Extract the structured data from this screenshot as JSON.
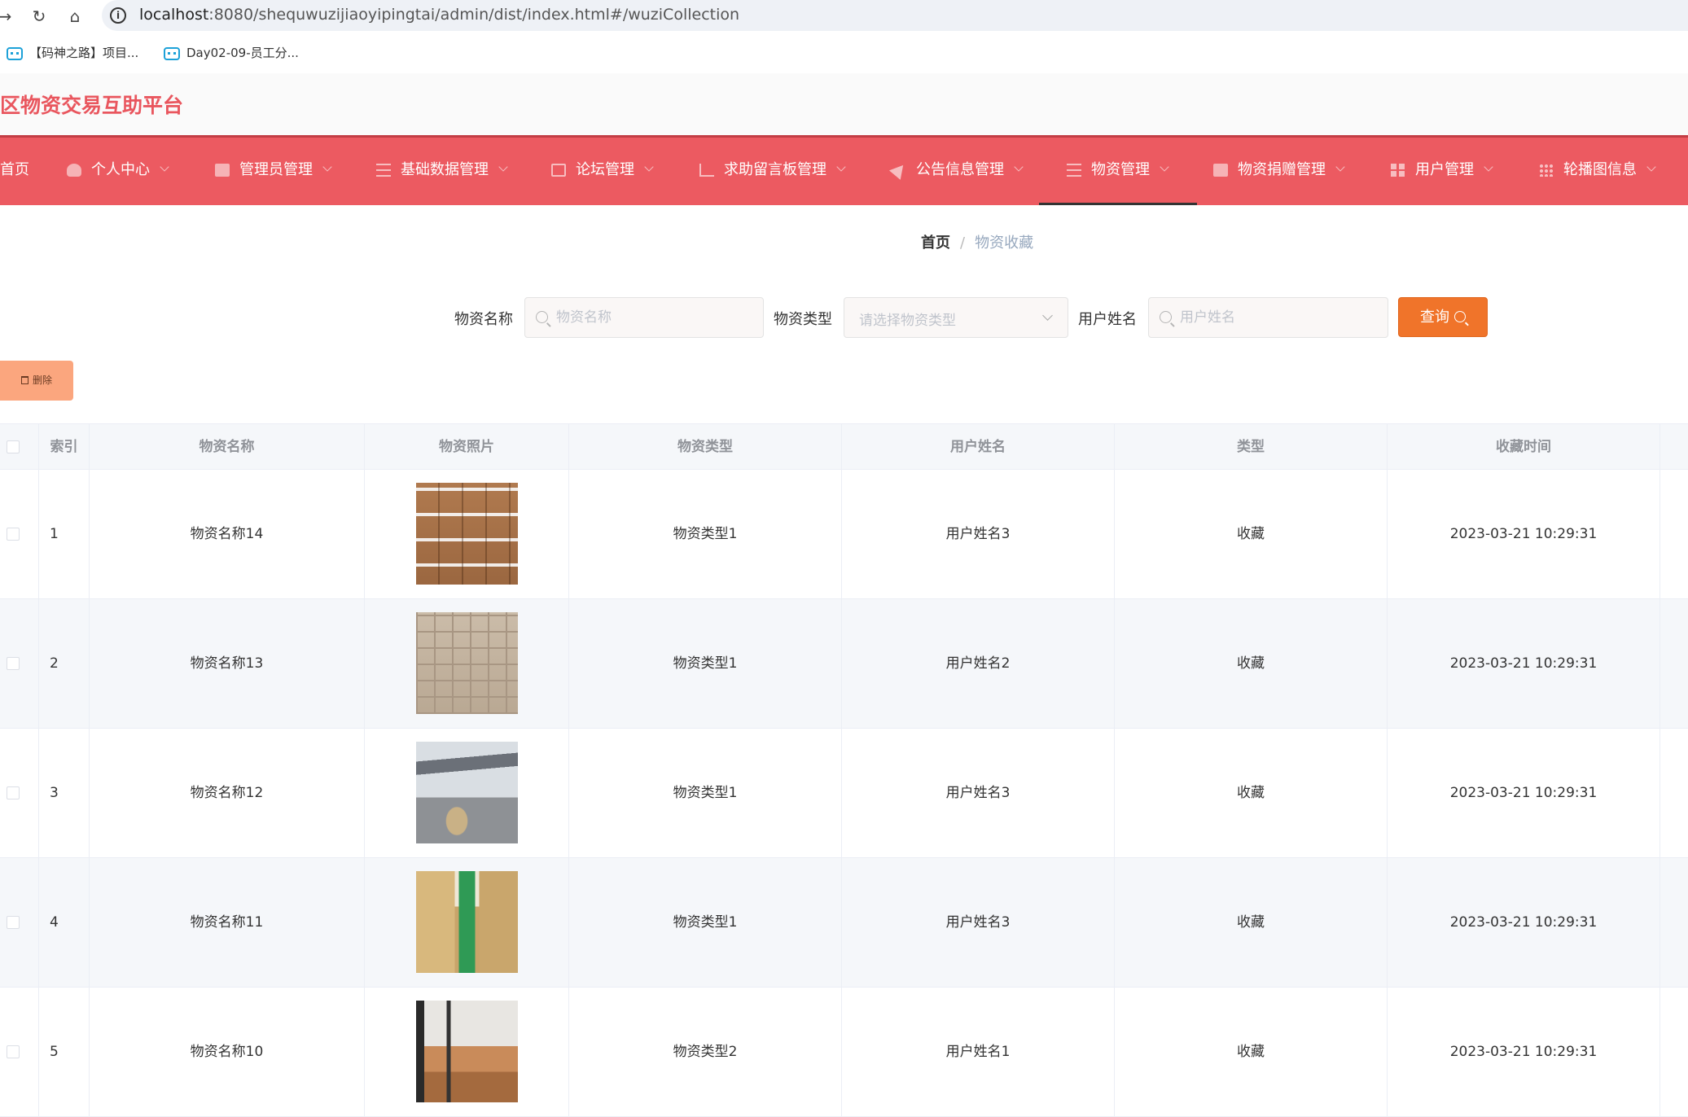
{
  "browser": {
    "url_host": "localhost",
    "url_rest": ":8080/shequwuzijiaoyipingtai/admin/dist/index.html#/wuziCollection",
    "bookmarks": [
      "【码神之路】项目...",
      "Day02-09-员工分..."
    ]
  },
  "app": {
    "title": "区物资交易互助平台",
    "accent": "#ec5a61"
  },
  "nav": {
    "items": [
      {
        "label": "首页",
        "icon": "home-icon"
      },
      {
        "label": "个人中心",
        "icon": "user-icon"
      },
      {
        "label": "管理员管理",
        "icon": "card-icon"
      },
      {
        "label": "基础数据管理",
        "icon": "sliders-icon"
      },
      {
        "label": "论坛管理",
        "icon": "chat-icon"
      },
      {
        "label": "求助留言板管理",
        "icon": "crop-icon"
      },
      {
        "label": "公告信息管理",
        "icon": "send-icon"
      },
      {
        "label": "物资管理",
        "icon": "menu-icon",
        "active": true
      },
      {
        "label": "物资捐赠管理",
        "icon": "box-icon"
      },
      {
        "label": "用户管理",
        "icon": "grid-icon"
      },
      {
        "label": "轮播图信息",
        "icon": "dots-icon"
      }
    ]
  },
  "breadcrumb": {
    "home": "首页",
    "separator": "/",
    "current": "物资收藏"
  },
  "search": {
    "name_label": "物资名称",
    "name_placeholder": "物资名称",
    "type_label": "物资类型",
    "type_placeholder": "请选择物资类型",
    "user_label": "用户姓名",
    "user_placeholder": "用户姓名",
    "query_label": "查询"
  },
  "toolbar": {
    "delete_label": "删除"
  },
  "table": {
    "columns": [
      "索引",
      "物资名称",
      "物资照片",
      "物资类型",
      "用户姓名",
      "类型",
      "收藏时间"
    ],
    "rows": [
      {
        "index": "1",
        "name": "物资名称14",
        "photo": "stacked-boxes-photo",
        "type": "物资类型1",
        "user": "用户姓名3",
        "kind": "收藏",
        "time": "2023-03-21 10:29:31"
      },
      {
        "index": "2",
        "name": "物资名称13",
        "photo": "box-wall-photo",
        "type": "物资类型1",
        "user": "用户姓名2",
        "kind": "收藏",
        "time": "2023-03-21 10:29:31"
      },
      {
        "index": "3",
        "name": "物资名称12",
        "photo": "cargo-plane-photo",
        "type": "物资类型1",
        "user": "用户姓名3",
        "kind": "收藏",
        "time": "2023-03-21 10:29:31"
      },
      {
        "index": "4",
        "name": "物资名称11",
        "photo": "warehouse-aisle-photo",
        "type": "物资类型1",
        "user": "用户姓名3",
        "kind": "收藏",
        "time": "2023-03-21 10:29:31"
      },
      {
        "index": "5",
        "name": "物资名称10",
        "photo": "room-supplies-photo",
        "type": "物资类型2",
        "user": "用户姓名1",
        "kind": "收藏",
        "time": "2023-03-21 10:29:31"
      }
    ]
  }
}
